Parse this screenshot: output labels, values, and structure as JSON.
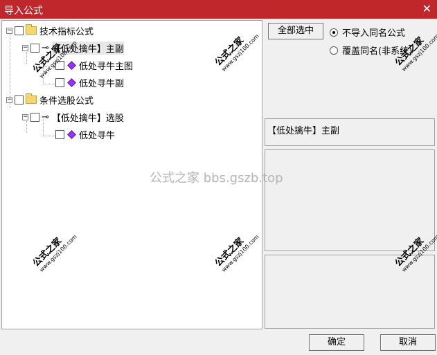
{
  "window": {
    "title": "导入公式",
    "close_glyph": "✕"
  },
  "tree": {
    "nodes": [
      {
        "label": "技术指标公式",
        "type": "folder"
      },
      {
        "label": "【低处擒牛】主副",
        "type": "formula"
      },
      {
        "label": "低处寻牛主图",
        "type": "indicator"
      },
      {
        "label": "低处寻牛副",
        "type": "indicator"
      },
      {
        "label": "条件选股公式",
        "type": "folder"
      },
      {
        "label": "【低处擒牛】选股",
        "type": "formula"
      },
      {
        "label": "低处寻牛",
        "type": "indicator"
      }
    ],
    "expander_glyph": "−"
  },
  "options": {
    "select_all_label": "全部选中",
    "no_import_same_name": "不导入同名公式",
    "overwrite_same_name": "覆盖同名(非系统)",
    "selected_option": "no_import"
  },
  "info_panel": {
    "text": "【低处擒牛】主副"
  },
  "buttons": {
    "ok": "确定",
    "cancel": "取消"
  },
  "watermarks": {
    "main": "公式之家",
    "site": "www.gszj100.com",
    "center": "公式之家 bbs.gszb.top"
  },
  "colors": {
    "titlebar": "#c0272d",
    "folder": "#f5d76e",
    "indicator_icon": "#9b30ff"
  },
  "icons": {
    "key": "⊸"
  }
}
